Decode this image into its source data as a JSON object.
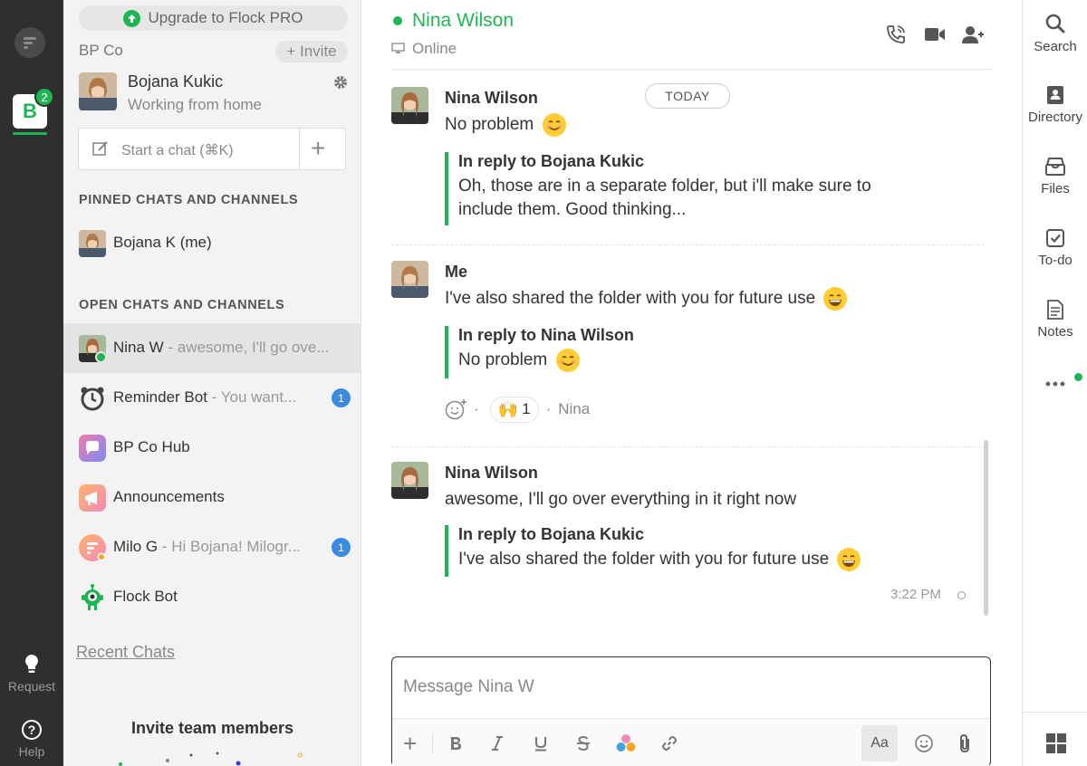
{
  "rail": {
    "workspace_letter": "B",
    "workspace_badge": "2",
    "request_label": "Request",
    "help_label": "Help"
  },
  "sidebar": {
    "upgrade_label": "Upgrade to Flock PRO",
    "team_name": "BP Co",
    "invite_label": "+ Invite",
    "me": {
      "name": "Bojana Kukic",
      "status": "Working from home"
    },
    "start_chat_placeholder": "Start a chat (⌘K)",
    "pinned_header": "PINNED CHATS AND CHANNELS",
    "pinned": [
      {
        "name": "Bojana K (me)"
      }
    ],
    "open_header": "OPEN CHATS AND CHANNELS",
    "open": [
      {
        "name": "Nina W",
        "preview": " - awesome, I'll go ove...",
        "unread": ""
      },
      {
        "name": "Reminder Bot",
        "preview": " - You want...",
        "unread": "1"
      },
      {
        "name": "BP Co Hub",
        "preview": "",
        "unread": ""
      },
      {
        "name": "Announcements",
        "preview": "",
        "unread": ""
      },
      {
        "name": "Milo G",
        "preview": " - Hi Bojana! Milogr...",
        "unread": "1"
      },
      {
        "name": "Flock Bot",
        "preview": "",
        "unread": ""
      }
    ],
    "recent_chats": "Recent Chats",
    "invite_team": "Invite team members"
  },
  "header": {
    "contact_name": "Nina Wilson",
    "presence": "Online"
  },
  "conversation": {
    "date_divider": "TODAY",
    "messages": [
      {
        "sender": "Nina Wilson",
        "text": "No problem",
        "emoji": "smiling-face",
        "reply_to": "In reply to Bojana Kukic",
        "reply_text": "Oh, those are in a separate folder, but i'll make sure to include them. Good thinking..."
      },
      {
        "sender": "Me",
        "text": "I've also shared the folder with you for future use",
        "emoji": "grinning-face",
        "reply_to": "In reply to Nina Wilson",
        "reply_text": "No problem",
        "reply_emoji": "smiling-face",
        "reaction_emoji": "🙌",
        "reaction_count": "1",
        "reaction_by": "Nina"
      },
      {
        "sender": "Nina Wilson",
        "text": "awesome, I'll go over everything in it right now",
        "reply_to": "In reply to Bojana Kukic",
        "reply_text": "I've also shared the folder with you for future use",
        "reply_emoji": "grinning-face",
        "time": "3:22 PM"
      }
    ]
  },
  "composer": {
    "placeholder": "Message Nina W",
    "format_label": "Aa"
  },
  "apps": [
    {
      "label": "Search",
      "icon": "search-icon"
    },
    {
      "label": "Directory",
      "icon": "directory-icon"
    },
    {
      "label": "Files",
      "icon": "files-icon"
    },
    {
      "label": "To-do",
      "icon": "todo-icon"
    },
    {
      "label": "Notes",
      "icon": "notes-icon"
    }
  ],
  "colors": {
    "brand_green": "#1fb554",
    "unread_blue": "#3a8be0",
    "rail_dark": "#2f2f2f"
  }
}
